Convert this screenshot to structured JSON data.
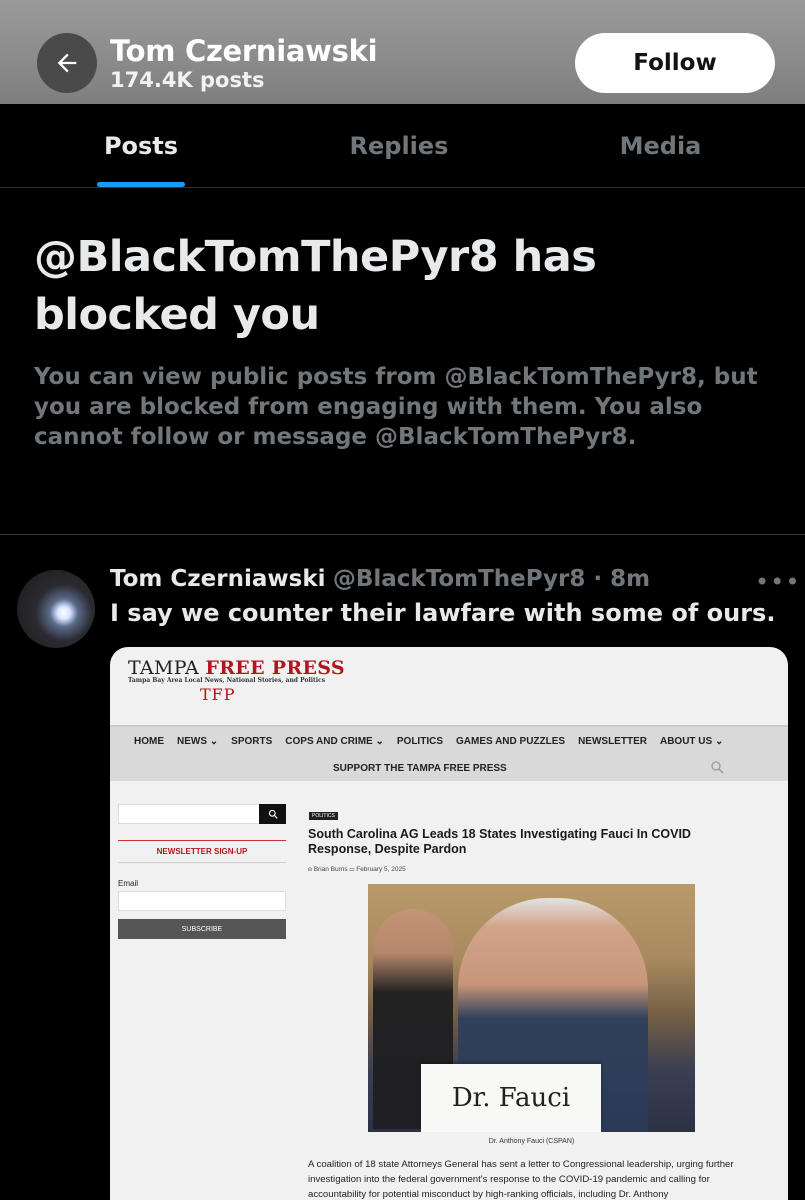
{
  "header": {
    "back_icon": "arrow-left-icon",
    "name": "Tom Czerniawski",
    "post_count": "174.4K posts",
    "follow_label": "Follow"
  },
  "tabs": [
    {
      "label": "Posts",
      "active": true
    },
    {
      "label": "Replies",
      "active": false
    },
    {
      "label": "Media",
      "active": false
    }
  ],
  "blocked": {
    "title": "@BlackTomThePyr8 has blocked you",
    "message": "You can view public posts from @BlackTomThePyr8, but you are blocked from engaging with them. You also cannot follow or message @BlackTomThePyr8."
  },
  "post": {
    "name": "Tom Czerniawski",
    "handle_time": "@BlackTomThePyr8 · 8m",
    "more_icon": "more-icon",
    "more_label": "•••",
    "text": "I say we counter their lawfare with some of ours."
  },
  "embed": {
    "site_title_plain": "TAMPA ",
    "site_title_red": "FREE PRESS",
    "tagline": "Tampa Bay Area Local News, National Stories, and Politics",
    "logo": "TFP",
    "nav": [
      "HOME",
      "NEWS ⌄",
      "SPORTS",
      "COPS AND CRIME ⌄",
      "POLITICS",
      "GAMES AND PUZZLES",
      "NEWSLETTER",
      "ABOUT US ⌄"
    ],
    "support": "SUPPORT THE TAMPA FREE PRESS",
    "sidebar": {
      "newsletter": "NEWSLETTER SIGN-UP",
      "email_label": "Email",
      "subscribe": "SUBSCRIBE"
    },
    "article": {
      "tag": "POLITICS",
      "title": "South Carolina AG Leads 18 States Investigating Fauci In COVID Response, Despite Pardon",
      "meta": "⍝ Brian Burns   ▭ February 5, 2025",
      "nameplate": "Dr. Fauci",
      "caption": "Dr. Anthony Fauci (CSPAN)",
      "body": "A coalition of 18 state Attorneys General has sent a letter to Congressional leadership, urging further investigation into the federal government's response to the COVID-19 pandemic and calling for accountability for potential misconduct by high-ranking officials, including Dr. Anthony"
    }
  },
  "colors": {
    "accent": "#1d9bf0",
    "background": "#000000",
    "muted_text": "#71767b",
    "brand_red": "#b3151d"
  }
}
